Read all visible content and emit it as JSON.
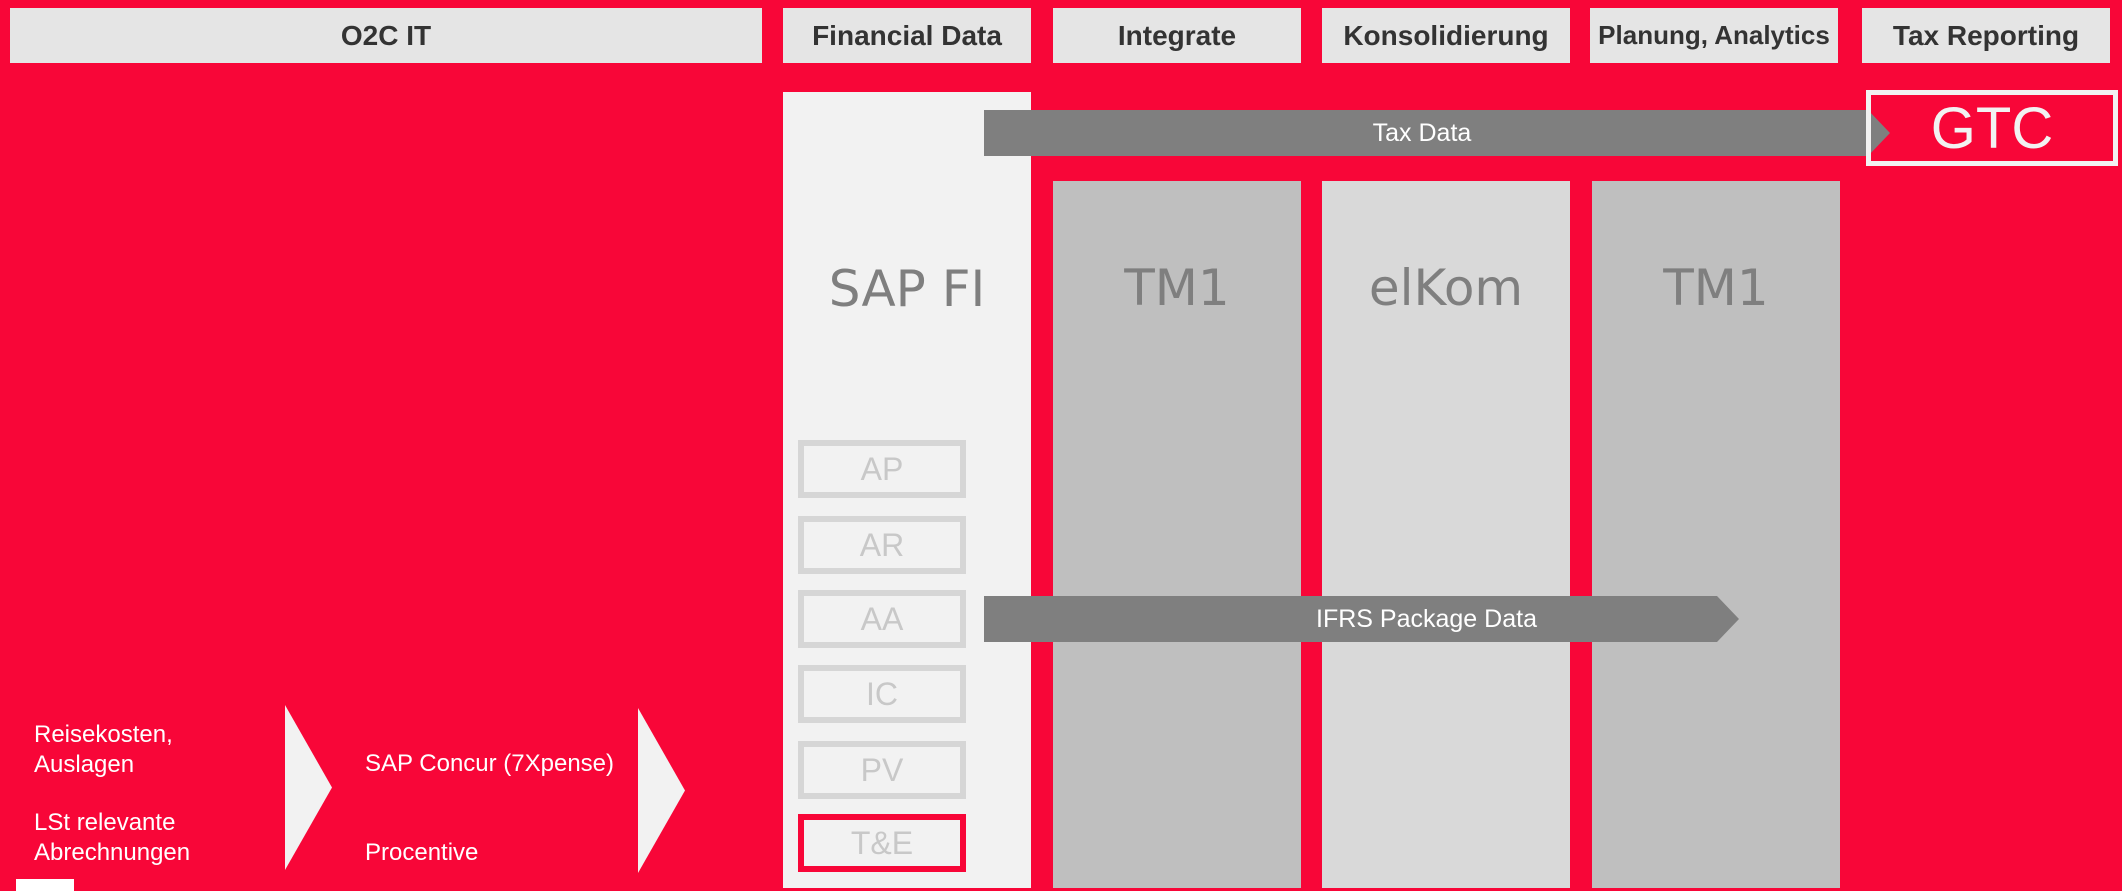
{
  "headers": [
    "O2C IT",
    "Financial Data",
    "Integrate",
    "Konsolidierung",
    "Planung, Analytics",
    "Tax Reporting"
  ],
  "systems": {
    "sap_fi": "SAP FI",
    "integrate": "TM1",
    "konsolidierung": "elKom",
    "planung": "TM1"
  },
  "modules": [
    "AP",
    "AR",
    "AA",
    "IC",
    "PV",
    "T&E"
  ],
  "tax_data_label": "Tax Data",
  "ifrs_label": "IFRS Package Data",
  "gtc_label": "GTC",
  "o2c": {
    "source_line1": "Reisekosten,",
    "source_line2": "Auslagen",
    "source_line3": "LSt relevante",
    "source_line4": "Abrechnungen",
    "system1": "SAP Concur (7Xpense)",
    "system2": "Procentive"
  },
  "colors": {
    "background": "#f80638",
    "header": "#e5e5e5",
    "arrow": "#7f7f7f",
    "column_light": "#f2f2f2",
    "column_mid": "#bfbfbf",
    "column_pale": "#d9d9d9"
  }
}
